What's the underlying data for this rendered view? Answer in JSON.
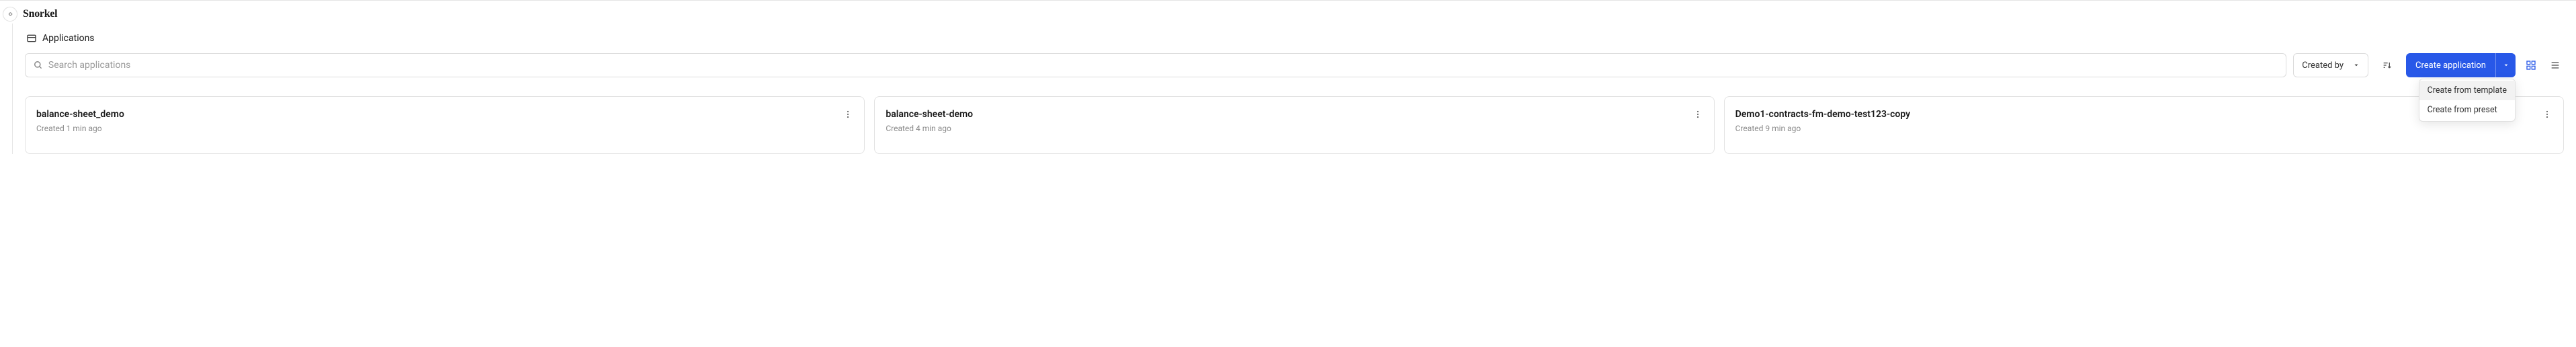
{
  "brand": "Snorkel",
  "breadcrumb": {
    "title": "Applications"
  },
  "search": {
    "placeholder": "Search applications",
    "value": ""
  },
  "createdBy": {
    "label": "Created by"
  },
  "createButton": {
    "label": "Create application"
  },
  "createMenu": {
    "items": [
      "Create from template",
      "Create from preset"
    ]
  },
  "cards": [
    {
      "title": "balance-sheet_demo",
      "subtitle": "Created 1 min ago"
    },
    {
      "title": "balance-sheet-demo",
      "subtitle": "Created 4 min ago"
    },
    {
      "title": "Demo1-contracts-fm-demo-test123-copy",
      "subtitle": "Created 9 min ago"
    }
  ]
}
